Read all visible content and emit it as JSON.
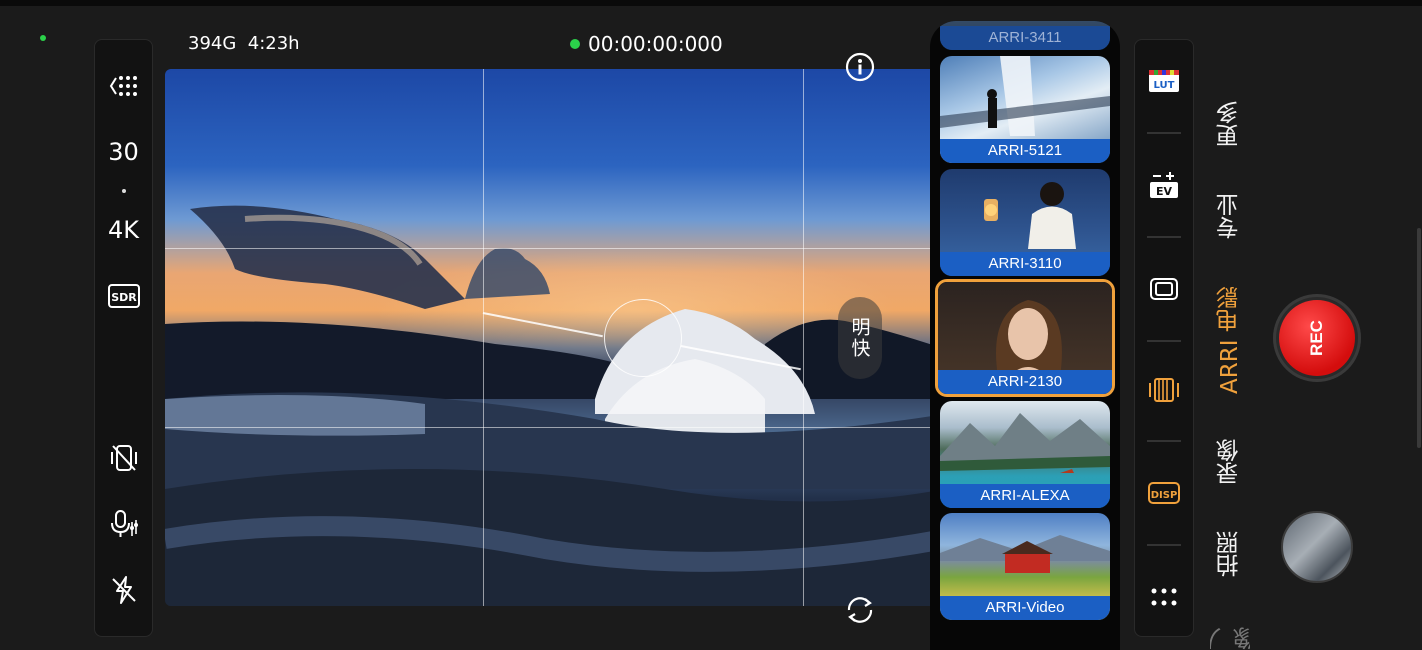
{
  "status": {
    "storage": "394G",
    "remaining_time": "4:23h",
    "timecode": "00:00:00:000"
  },
  "left_rail": {
    "fps": "30",
    "resolution": "4K",
    "dynamic_range": "SDR"
  },
  "viewfinder": {
    "look_label": "明快"
  },
  "luts": [
    {
      "label": "ARRI-3411"
    },
    {
      "label": "ARRI-5121"
    },
    {
      "label": "ARRI-3110"
    },
    {
      "label": "ARRI-2130",
      "selected": true
    },
    {
      "label": "ARRI-ALEXA"
    },
    {
      "label": "ARRI-Video"
    }
  ],
  "modes": {
    "more": "更多",
    "pro": "专业",
    "arri": "ARRI 电影",
    "video": "录像",
    "photo": "拍照",
    "portrait_partial": "人像"
  },
  "record": {
    "label": "REC"
  },
  "colors": {
    "accent": "#f0a13c",
    "record": "#e01212",
    "lut_label_bg": "#1b5fc4",
    "status_green": "#2bd14a"
  }
}
